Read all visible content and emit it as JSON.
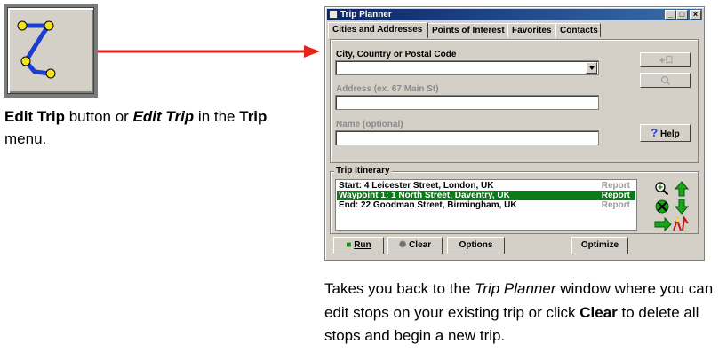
{
  "caption_left": {
    "bold1": "Edit Trip",
    "text1": " button or ",
    "bold_italic": "Edit Trip",
    "text2": " in the ",
    "bold2": "Trip",
    "text3": " menu."
  },
  "caption_right": {
    "text1": "Takes you back to the ",
    "italic": "Trip Planner",
    "text2": " window where you can edit stops on your existing trip or click ",
    "bold": "Clear",
    "text3": " to delete all stops and begin a new trip."
  },
  "window": {
    "title": "Trip Planner",
    "controls": {
      "minimize": "_",
      "maximize": "□",
      "close": "×"
    },
    "tabs": [
      "Cities and Addresses",
      "Points of Interest",
      "Favorites",
      "Contacts"
    ],
    "active_tab": 0,
    "fields": {
      "city_label": "City, Country or Postal Code",
      "city_value": "",
      "address_label": "Address (ex. 67 Main St)",
      "address_value": "",
      "name_label": "Name (optional)",
      "name_value": ""
    },
    "side_buttons": {
      "help": "Help",
      "add_icon": "add-stop-icon",
      "find_icon": "find-icon"
    },
    "itinerary": {
      "label": "Trip Itinerary",
      "rows": [
        {
          "text": "Start: 4 Leicester Street, London, UK",
          "report": "Report",
          "selected": false
        },
        {
          "text": "Waypoint 1: 1 North Street, Daventry, UK",
          "report": "Report",
          "selected": true
        },
        {
          "text": "End: 22 Goodman Street, Birmingham, UK",
          "report": "Report",
          "selected": false
        }
      ]
    },
    "bottom_buttons": {
      "run": "Run",
      "clear": "Clear",
      "options": "Options",
      "optimize": "Optimize"
    },
    "colors": {
      "titlebar": "#0a246a",
      "selection": "#0a7a1a",
      "arrow": "#e8231a"
    }
  }
}
